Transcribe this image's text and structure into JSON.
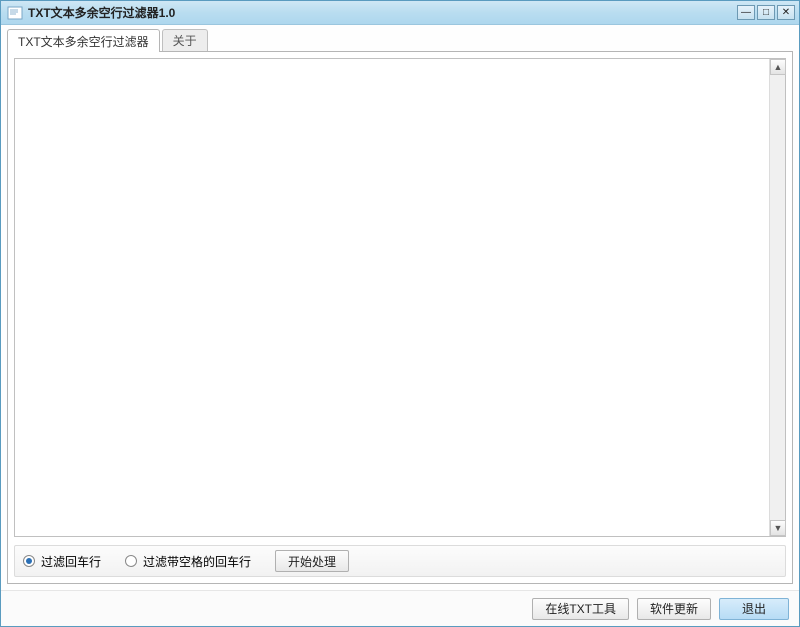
{
  "window": {
    "title": "TXT文本多余空行过滤器1.0"
  },
  "tabs": {
    "main": "TXT文本多余空行过滤器",
    "about": "关于"
  },
  "textarea": {
    "value": ""
  },
  "options": {
    "radio1": "过滤回车行",
    "radio2": "过滤带空格的回车行",
    "start": "开始处理"
  },
  "footer": {
    "online": "在线TXT工具",
    "update": "软件更新",
    "exit": "退出"
  }
}
